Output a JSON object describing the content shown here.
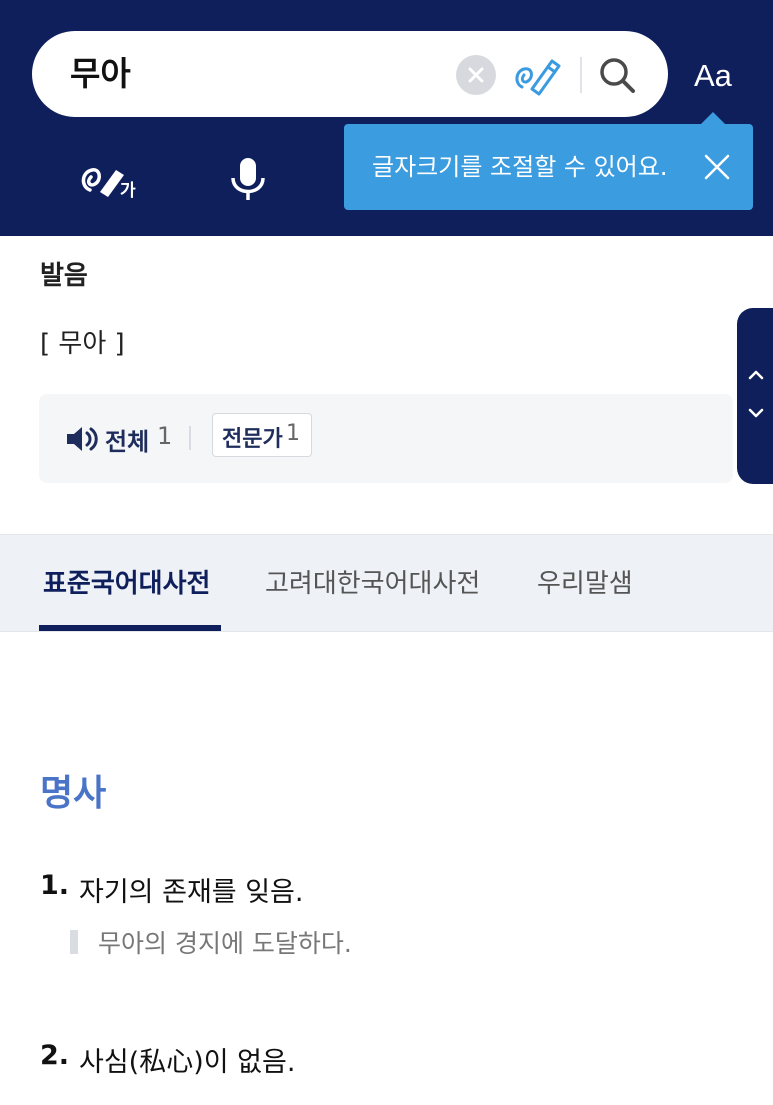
{
  "header": {
    "search_query": "무아",
    "font_size_label": "Aa",
    "tooltip_text": "글자크기를 조절할 수 있어요.",
    "hand_tool_badge": "가"
  },
  "pronunciation": {
    "label": "발음",
    "value": "[ 무아 ]",
    "audio_all_label": "전체",
    "audio_all_count": "1",
    "expert_label": "전문가",
    "expert_count": "1"
  },
  "tabs": [
    {
      "label": "표준국어대사전",
      "active": true
    },
    {
      "label": "고려대한국어대사전",
      "active": false
    },
    {
      "label": "우리말샘",
      "active": false
    }
  ],
  "entry": {
    "part_of_speech": "명사",
    "definitions": [
      {
        "number": "1.",
        "text": "자기의 존재를 잊음.",
        "example": "무아의 경지에 도달하다."
      },
      {
        "number": "2.",
        "text": "사심(私心)이 없음."
      }
    ]
  },
  "colors": {
    "header_bg": "#0f1f5c",
    "tooltip_bg": "#3c9ce0",
    "part_of_speech": "#4a74c7"
  }
}
